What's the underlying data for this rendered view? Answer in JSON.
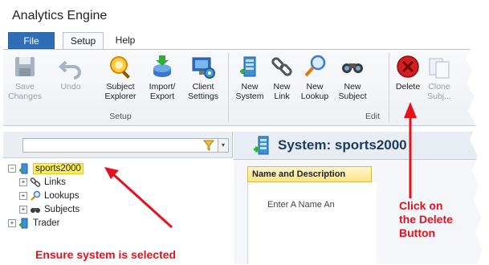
{
  "app_title": "Analytics Engine",
  "tabs": {
    "file": "File",
    "setup": "Setup",
    "help": "Help"
  },
  "ribbon": {
    "buttons": {
      "save": "Save Changes",
      "undo": "Undo",
      "subject_explorer": "Subject Explorer",
      "import_export": "Import/ Export",
      "client_settings": "Client Settings",
      "new_system": "New System",
      "new_link": "New Link",
      "new_lookup": "New Lookup",
      "new_subject": "New Subject",
      "delete": "Delete",
      "clone": "Clone Subj..."
    },
    "groups": {
      "setup": "Setup",
      "edit": "Edit"
    }
  },
  "search": {
    "value": ""
  },
  "tree": {
    "nodes": {
      "sports2000": "sports2000",
      "links": "Links",
      "lookups": "Lookups",
      "subjects": "Subjects",
      "trader": "Trader"
    }
  },
  "system_panel": {
    "title": "System: sports2000",
    "tab_label": "Name and Description",
    "placeholder": "Enter A Name An"
  },
  "annotations": {
    "ensure": "Ensure system is selected",
    "click_delete": [
      "Click on",
      "the Delete",
      "Button"
    ]
  },
  "colors": {
    "file_tab": "#2f6db5",
    "selection": "#ffef5a",
    "annotation": "#e8101a"
  }
}
